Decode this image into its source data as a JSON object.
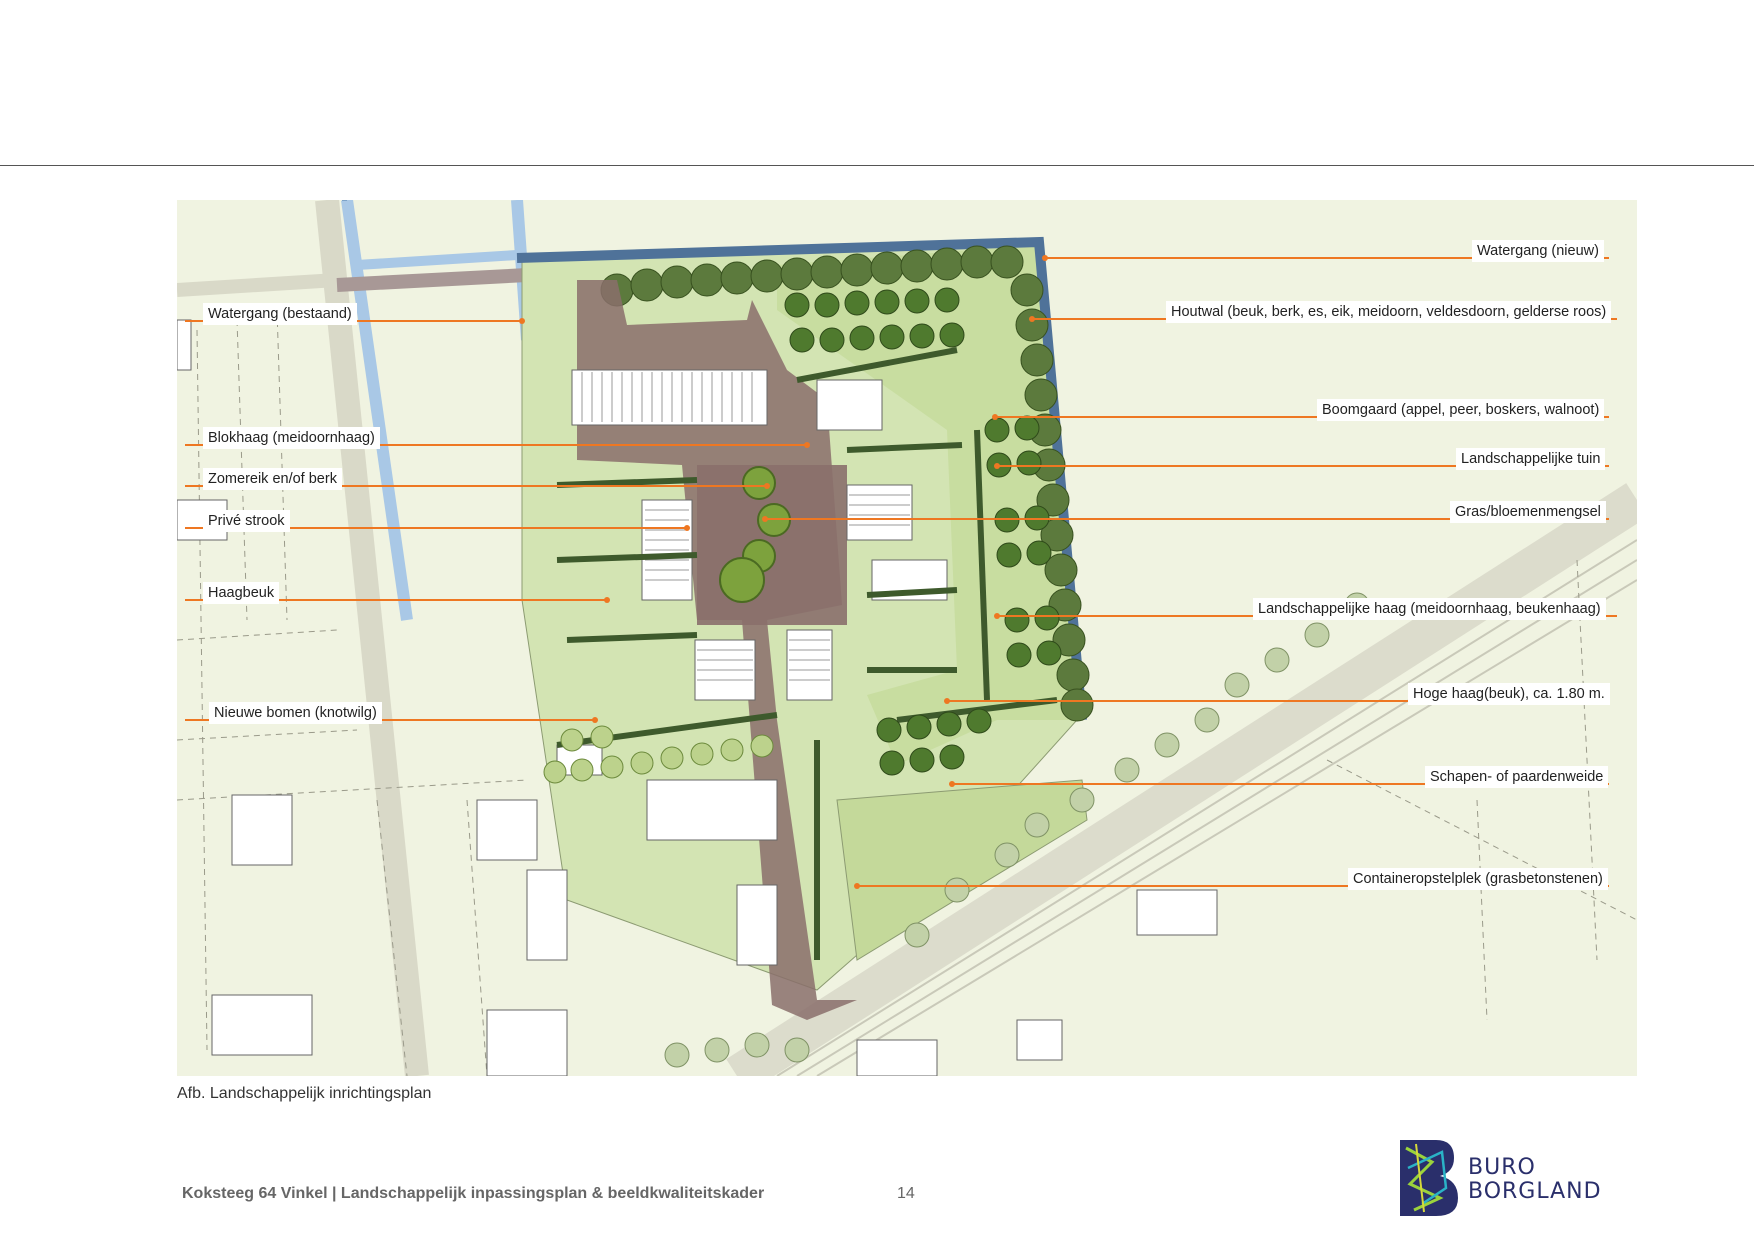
{
  "figure": {
    "caption": "Afb. Landschappelijk inrichtingsplan"
  },
  "labels": {
    "watergang_nieuw": "Watergang (nieuw)",
    "watergang_bestaand": "Watergang (bestaand)",
    "houtwal": "Houtwal (beuk, berk, es, eik, meidoorn, veldesdoorn, gelderse roos)",
    "boomgaard": "Boomgaard (appel, peer, boskers, walnoot)",
    "blokhaag": "Blokhaag (meidoornhaag)",
    "landschappelijke_tuin": "Landschappelijke tuin",
    "zomereik": "Zomereik en/of berk",
    "gras": "Gras/bloemenmengsel",
    "prive_strook": "Privé strook",
    "haagbeuk": "Haagbeuk",
    "landschappelijke_haag": "Landschappelijke haag (meidoornhaag, beukenhaag)",
    "hoge_haag": "Hoge haag(beuk), ca. 1.80 m.",
    "nieuwe_bomen": "Nieuwe bomen (knotwilg)",
    "schapen": "Schapen- of paardenweide",
    "container": "Containeropstelplek (grasbetonstenen)"
  },
  "footer": {
    "title": "Koksteeg 64 Vinkel | Landschappelijk inpassingsplan & beeldkwaliteitskader",
    "page_number": "14"
  },
  "logo": {
    "line1": "BURO",
    "line2": "BORGLAND"
  },
  "colors": {
    "leader": "#ee7722",
    "water_new": "#4f7299",
    "water_existing": "#a9c8e6",
    "paving": "#8a6f6b",
    "lawn": "#cfe0ad",
    "meadow": "#c4d99a",
    "tree": "#4f7a2e",
    "hedge": "#3e5a2c"
  }
}
